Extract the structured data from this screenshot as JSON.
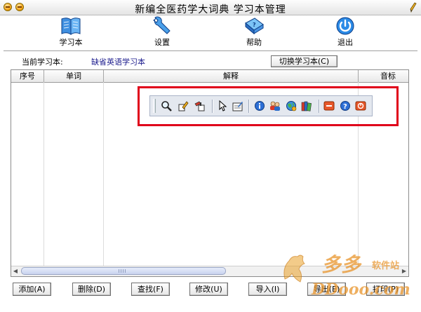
{
  "window": {
    "title": "新编全医药学大词典 学习本管理"
  },
  "toolbar": [
    {
      "label": "学习本",
      "icon": "book-icon"
    },
    {
      "label": "设置",
      "icon": "wrench-icon"
    },
    {
      "label": "帮助",
      "icon": "help-book-icon"
    },
    {
      "label": "退出",
      "icon": "power-icon"
    }
  ],
  "current": {
    "label": "当前学习本:",
    "value": "缺省英语学习本",
    "switch_label": "切换学习本(C)"
  },
  "grid": {
    "columns": [
      "序号",
      "单词",
      "解释",
      "音标"
    ],
    "rows": []
  },
  "buttons": {
    "add": "添加(A)",
    "delete": "删除(D)",
    "find": "查找(F)",
    "modify": "修改(U)",
    "import": "导入(I)",
    "export": "导出(E)",
    "print": "打印(P)"
  },
  "floating_toolbar": {
    "icons": [
      "search-icon",
      "edit-icon",
      "paint-icon",
      "pointer-icon",
      "notepad-icon",
      "info-icon",
      "users-icon",
      "globe-icon",
      "books-icon",
      "minimize-icon",
      "help-icon",
      "close-icon"
    ]
  },
  "watermark": {
    "text_top": "多多",
    "text_sub": "软件站",
    "text_url": "DDooo.com"
  },
  "colors": {
    "highlight_box": "#e0001a",
    "current_value": "#1a1a8c"
  }
}
